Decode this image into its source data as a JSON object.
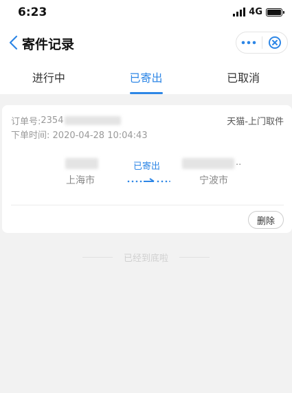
{
  "status_bar": {
    "time": "6:23",
    "network": "4G"
  },
  "nav": {
    "title": "寄件记录"
  },
  "tabs": [
    {
      "label": "进行中",
      "active": false
    },
    {
      "label": "已寄出",
      "active": true
    },
    {
      "label": "已取消",
      "active": false
    }
  ],
  "order": {
    "order_label": "订单号:",
    "order_number_visible": "2354",
    "time_label": "下单时间:",
    "time_value": "2020-04-28 10:04:43",
    "channel": "天猫-上门取件",
    "from_city": "上海市",
    "to_city": "宁波市",
    "to_name_suffix": "..",
    "status": "已寄出",
    "delete_label": "删除"
  },
  "footer_hint": "已经到底啦",
  "colors": {
    "accent": "#2d86e6",
    "background": "#f2f2f2",
    "card": "#ffffff"
  }
}
